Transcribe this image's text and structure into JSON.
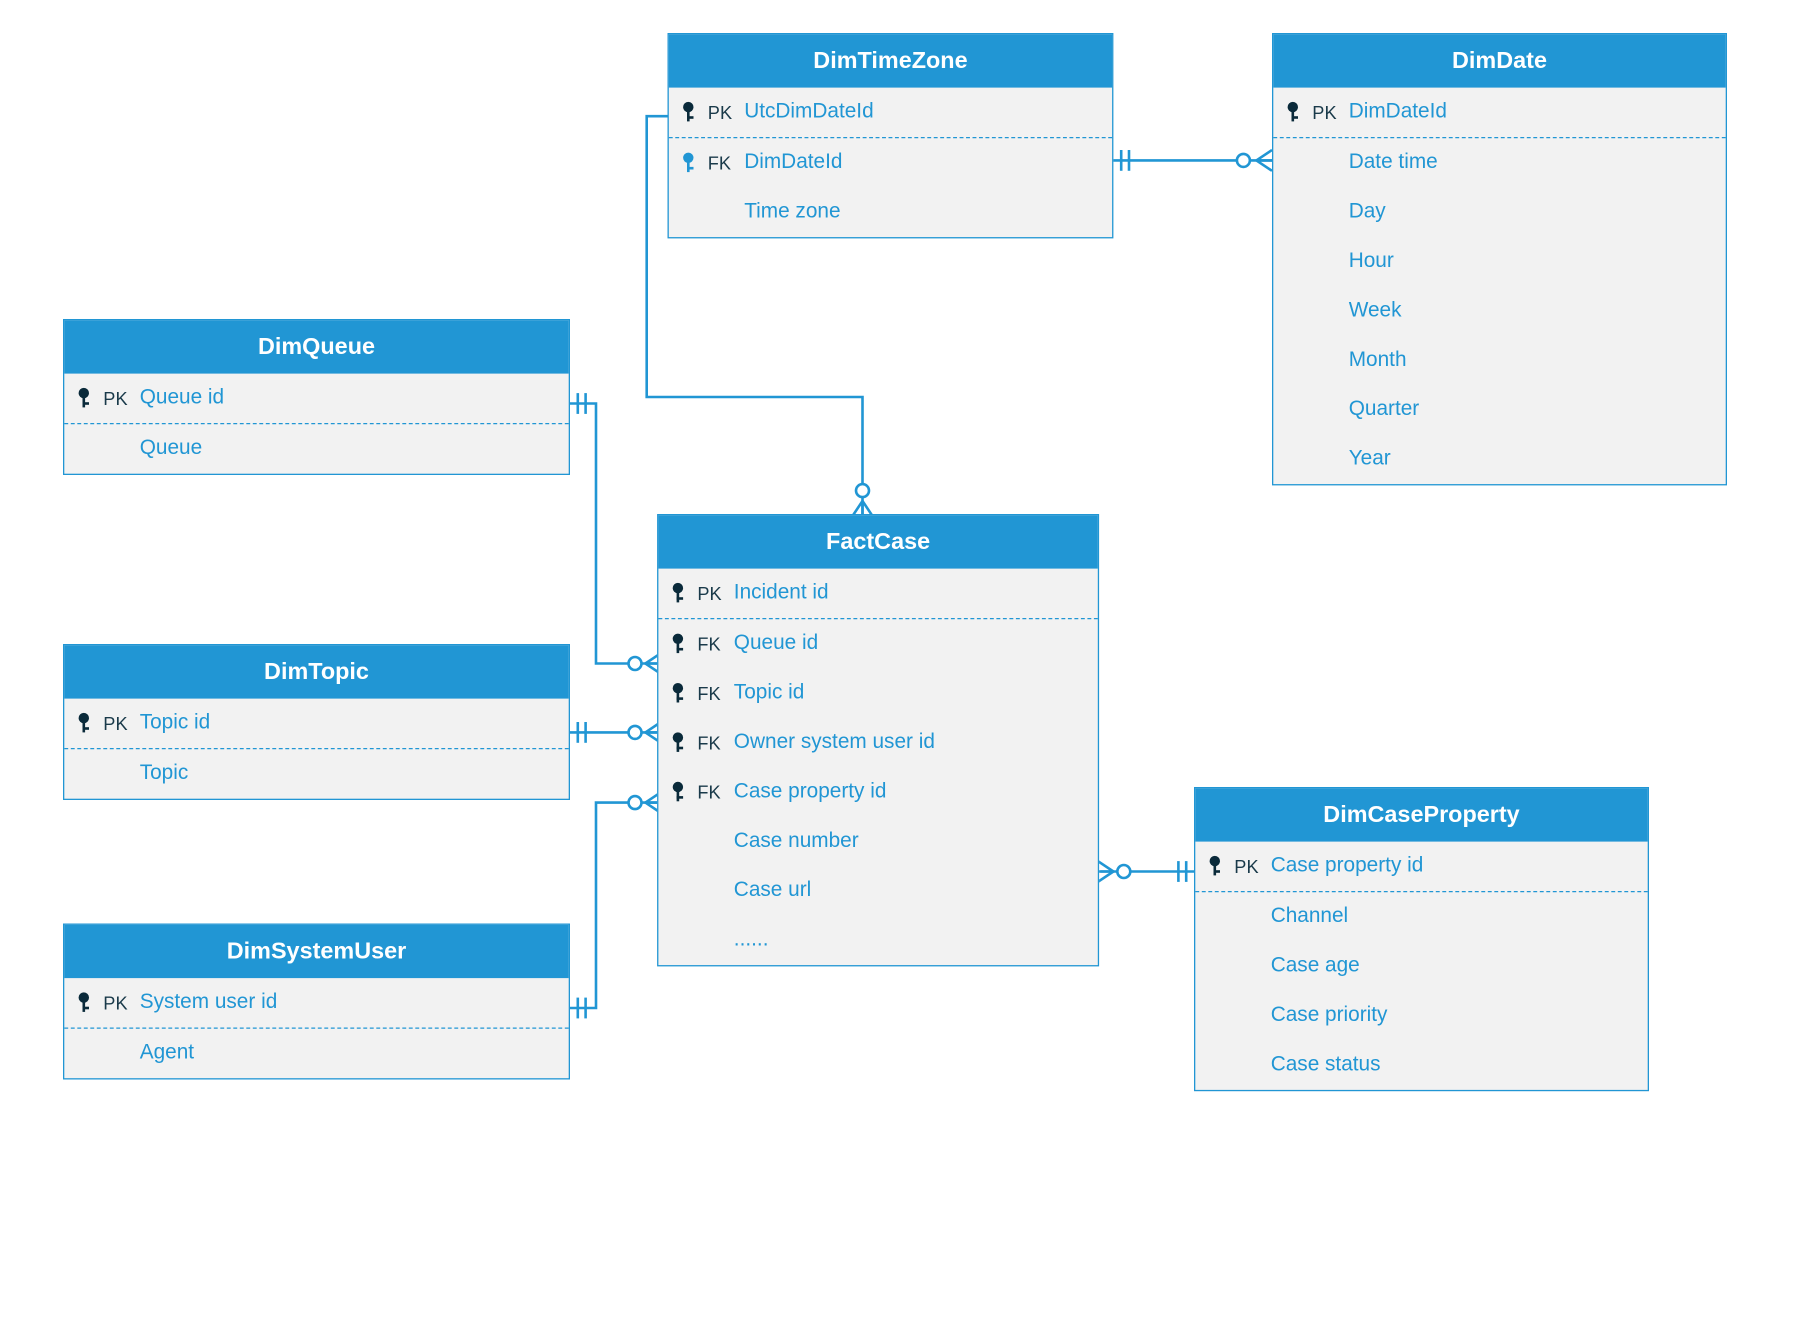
{
  "colors": {
    "accent": "#2196d4",
    "panel": "#f2f2f2",
    "keyIcon": "#0a2a3a"
  },
  "entities": {
    "dimTimeZone": {
      "title": "DimTimeZone",
      "rows": [
        {
          "key": "PK",
          "label": "UtcDimDateId"
        },
        {
          "key": "FK",
          "label": "DimDateId"
        },
        {
          "key": "",
          "label": "Time zone"
        }
      ]
    },
    "dimDate": {
      "title": "DimDate",
      "rows": [
        {
          "key": "PK",
          "label": "DimDateId"
        },
        {
          "key": "",
          "label": "Date time"
        },
        {
          "key": "",
          "label": "Day"
        },
        {
          "key": "",
          "label": "Hour"
        },
        {
          "key": "",
          "label": "Week"
        },
        {
          "key": "",
          "label": "Month"
        },
        {
          "key": "",
          "label": "Quarter"
        },
        {
          "key": "",
          "label": "Year"
        }
      ]
    },
    "dimQueue": {
      "title": "DimQueue",
      "rows": [
        {
          "key": "PK",
          "label": "Queue id"
        },
        {
          "key": "",
          "label": "Queue"
        }
      ]
    },
    "dimTopic": {
      "title": "DimTopic",
      "rows": [
        {
          "key": "PK",
          "label": "Topic id"
        },
        {
          "key": "",
          "label": "Topic"
        }
      ]
    },
    "dimSystemUser": {
      "title": "DimSystemUser",
      "rows": [
        {
          "key": "PK",
          "label": "System user id"
        },
        {
          "key": "",
          "label": "Agent"
        }
      ]
    },
    "factCase": {
      "title": "FactCase",
      "rows": [
        {
          "key": "PK",
          "label": "Incident id"
        },
        {
          "key": "FK",
          "label": "Queue id"
        },
        {
          "key": "FK",
          "label": "Topic id"
        },
        {
          "key": "FK",
          "label": "Owner system user id"
        },
        {
          "key": "FK",
          "label": "Case property id"
        },
        {
          "key": "",
          "label": "Case number"
        },
        {
          "key": "",
          "label": "Case url"
        },
        {
          "key": "",
          "label": "......"
        }
      ]
    },
    "dimCaseProperty": {
      "title": "DimCaseProperty",
      "rows": [
        {
          "key": "PK",
          "label": "Case property id"
        },
        {
          "key": "",
          "label": "Channel"
        },
        {
          "key": "",
          "label": "Case age"
        },
        {
          "key": "",
          "label": "Case priority"
        },
        {
          "key": "",
          "label": "Case status"
        }
      ]
    }
  },
  "relationships": [
    {
      "from": "FactCase.Queue id",
      "to": "DimQueue.Queue id",
      "type": "many-to-one"
    },
    {
      "from": "FactCase.Topic id",
      "to": "DimTopic.Topic id",
      "type": "many-to-one"
    },
    {
      "from": "FactCase.Owner system user id",
      "to": "DimSystemUser.System user id",
      "type": "many-to-one"
    },
    {
      "from": "FactCase.Case property id",
      "to": "DimCaseProperty.Case property id",
      "type": "many-to-one"
    },
    {
      "from": "FactCase (via DimTimeZone)",
      "to": "DimTimeZone.UtcDimDateId",
      "type": "many-to-one"
    },
    {
      "from": "DimTimeZone.DimDateId",
      "to": "DimDate.DimDateId",
      "type": "many-to-one"
    }
  ]
}
